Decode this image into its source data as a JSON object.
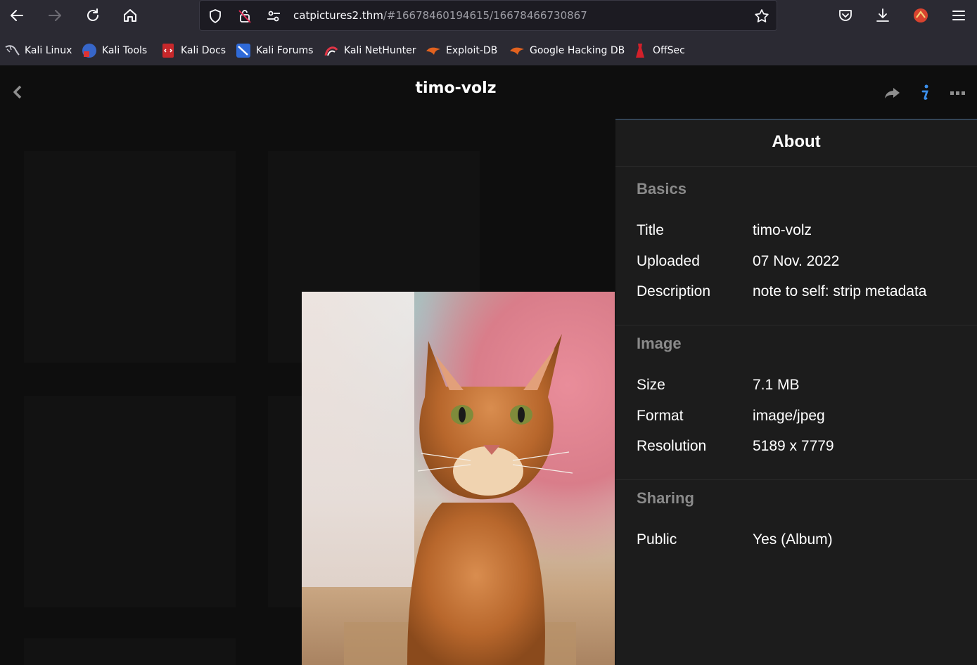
{
  "browser": {
    "url_host": "catpictures2.thm",
    "url_rest": "/#16678460194615/16678466730867",
    "bookmarks": [
      {
        "label": "Kali Linux",
        "icon": "kali-dragon-icon"
      },
      {
        "label": "Kali Tools",
        "icon": "kali-tools-icon"
      },
      {
        "label": "Kali Docs",
        "icon": "kali-docs-icon"
      },
      {
        "label": "Kali Forums",
        "icon": "kali-forums-icon"
      },
      {
        "label": "Kali NetHunter",
        "icon": "kali-nethunter-icon"
      },
      {
        "label": "Exploit-DB",
        "icon": "exploit-db-icon"
      },
      {
        "label": "Google Hacking DB",
        "icon": "ghdb-icon"
      },
      {
        "label": "OffSec",
        "icon": "offsec-icon"
      }
    ]
  },
  "viewer": {
    "title": "timo-volz"
  },
  "about": {
    "heading": "About",
    "sections": {
      "basics": {
        "heading": "Basics",
        "rows": [
          {
            "key": "Title",
            "value": "timo-volz"
          },
          {
            "key": "Uploaded",
            "value": "07 Nov. 2022"
          },
          {
            "key": "Description",
            "value": "note to self: strip metadata"
          }
        ]
      },
      "image": {
        "heading": "Image",
        "rows": [
          {
            "key": "Size",
            "value": "7.1 MB"
          },
          {
            "key": "Format",
            "value": "image/jpeg"
          },
          {
            "key": "Resolution",
            "value": "5189 x 7779"
          }
        ]
      },
      "sharing": {
        "heading": "Sharing",
        "rows": [
          {
            "key": "Public",
            "value": "Yes (Album)"
          }
        ]
      }
    }
  },
  "colors": {
    "accent_info": "#3b8eea",
    "panel_bg": "#1c1c1c"
  }
}
